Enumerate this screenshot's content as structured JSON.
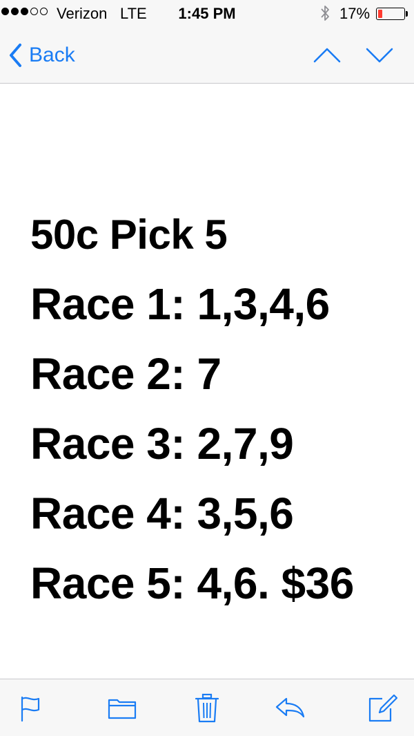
{
  "status_bar": {
    "carrier": "Verizon",
    "network": "LTE",
    "time": "1:45 PM",
    "battery_percent_label": "17%",
    "battery_level": 0.17,
    "signal_bars_filled": 3,
    "signal_bars_total": 5,
    "bluetooth_icon": "bluetooth-icon"
  },
  "nav": {
    "back_label": "Back",
    "previous_icon": "chevron-up-icon",
    "next_icon": "chevron-down-icon"
  },
  "message": {
    "lines": [
      "50c Pick 5",
      "Race 1: 1,3,4,6",
      "Race 2: 7",
      "Race 3: 2,7,9",
      "Race 4: 3,5,6",
      "Race 5: 4,6.  $36"
    ]
  },
  "toolbar": {
    "items": [
      {
        "icon": "flag-icon"
      },
      {
        "icon": "folder-icon"
      },
      {
        "icon": "trash-icon"
      },
      {
        "icon": "reply-icon"
      },
      {
        "icon": "compose-icon"
      }
    ]
  },
  "colors": {
    "accent": "#1a7cf4",
    "chrome_background": "#f7f7f7",
    "battery_low": "#ff3b30",
    "text": "#000000"
  }
}
